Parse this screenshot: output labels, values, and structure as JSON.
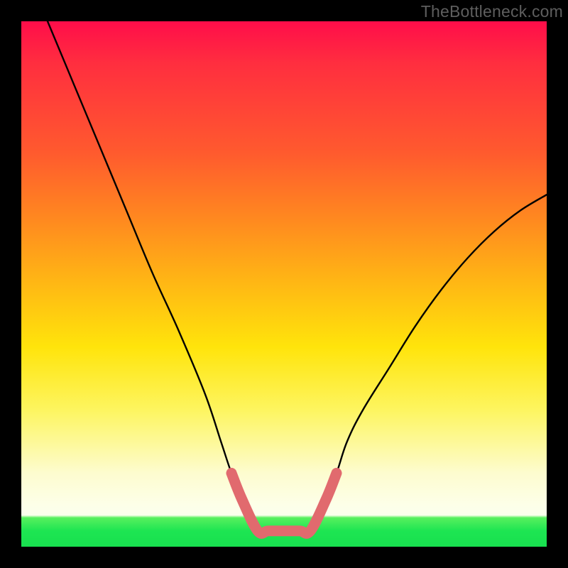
{
  "watermark": "TheBottleneck.com",
  "chart_data": {
    "type": "line",
    "title": "",
    "xlabel": "",
    "ylabel": "",
    "xlim": [
      0,
      100
    ],
    "ylim": [
      0,
      100
    ],
    "grid": false,
    "annotations": [],
    "series": [
      {
        "name": "black-curve",
        "color": "#000000",
        "x": [
          5,
          10,
          15,
          20,
          25,
          30,
          35,
          38,
          40,
          42,
          45,
          55,
          58,
          60,
          62,
          65,
          70,
          75,
          80,
          85,
          90,
          95,
          100
        ],
        "y": [
          100,
          88,
          76,
          64,
          52,
          41,
          29,
          20,
          14,
          9,
          3,
          3,
          9,
          14,
          20,
          26,
          34,
          42,
          49,
          55,
          60,
          64,
          67
        ]
      },
      {
        "name": "pink-highlight",
        "color": "#e16a6e",
        "x": [
          40,
          42,
          45,
          47,
          50,
          53,
          55,
          58,
          60
        ],
        "y": [
          14,
          9,
          3,
          3,
          3,
          3,
          3,
          9,
          14
        ]
      }
    ],
    "background_gradient": {
      "direction": "vertical",
      "stops": [
        {
          "pos": 0.0,
          "color": "#ff0d4a"
        },
        {
          "pos": 0.25,
          "color": "#ff5a2e"
        },
        {
          "pos": 0.5,
          "color": "#ffb814"
        },
        {
          "pos": 0.75,
          "color": "#fdf560"
        },
        {
          "pos": 0.92,
          "color": "#fdffe8"
        },
        {
          "pos": 0.95,
          "color": "#57f05e"
        },
        {
          "pos": 1.0,
          "color": "#18e04f"
        }
      ]
    }
  }
}
